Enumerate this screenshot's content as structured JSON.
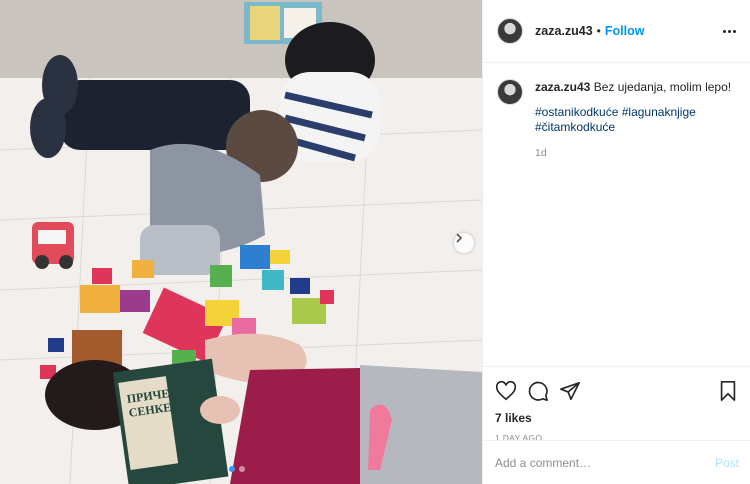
{
  "post": {
    "username": "zaza.zu43",
    "separator": "•",
    "follow_label": "Follow",
    "more_icon": "more-dots-icon",
    "caption_text": "Bez ujedanja, molim lepo!",
    "hashtags": [
      "#ostanikodkuće",
      "#lagunaknjige",
      "#čitamkodkuće"
    ],
    "time_ago": "1d",
    "likes": "7 likes",
    "date": "1 DAY AGO",
    "comment_placeholder": "Add a comment…",
    "post_label": "Post",
    "carousel": {
      "count": 2,
      "active": 0
    },
    "icons": [
      "heart-icon",
      "comment-icon",
      "share-icon",
      "bookmark-icon",
      "chevron-right-icon"
    ],
    "colors": {
      "link": "#0095f6",
      "hashtag": "#00376b",
      "muted": "#8e8e8e",
      "post_disabled": "#b2dffc"
    }
  }
}
